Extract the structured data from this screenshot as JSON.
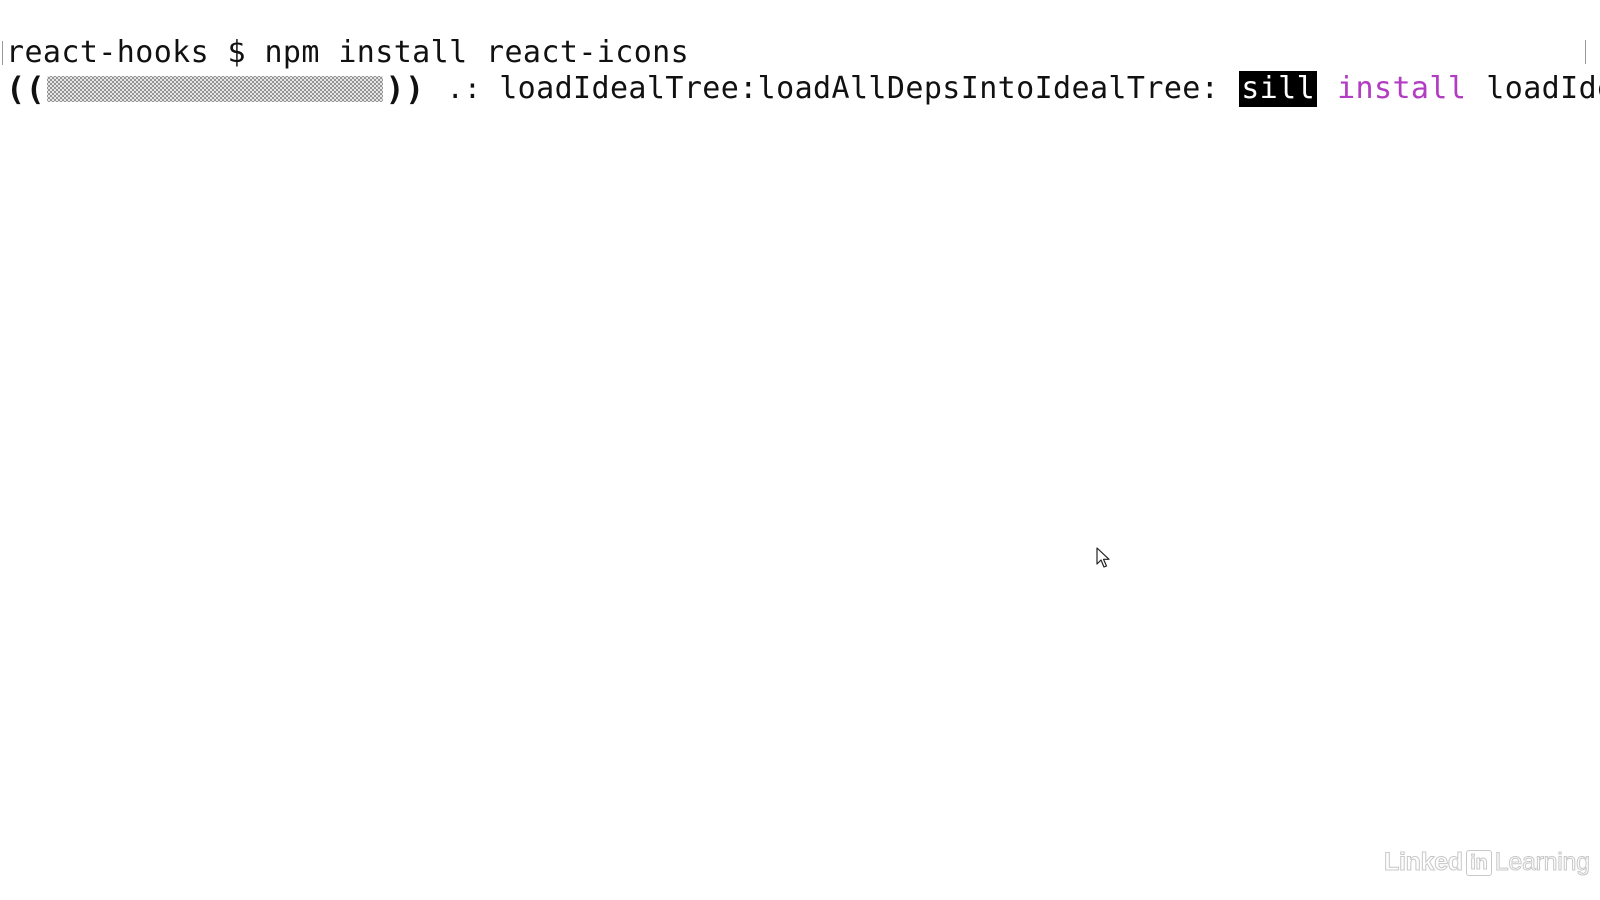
{
  "terminal": {
    "prompt": "react-hooks $ ",
    "command": "npm install react-icons",
    "progress_line": {
      "open_bracket": "((",
      "close_bracket": "))",
      "spinner": ".:",
      "stage": "loadIdealTree:loadAllDepsIntoIdealTree:",
      "level_badge": "sill",
      "action": "install",
      "detail": "loadIde"
    }
  },
  "colors": {
    "background": "#ffffff",
    "text": "#111111",
    "badge_bg": "#000000",
    "badge_text": "#ffffff",
    "install_word": "#b23cc2"
  },
  "watermark": {
    "brand_left": "Linked",
    "brand_box": "in",
    "brand_right": "Learning"
  },
  "icons": {
    "pointer": "mouse-cursor-icon"
  }
}
